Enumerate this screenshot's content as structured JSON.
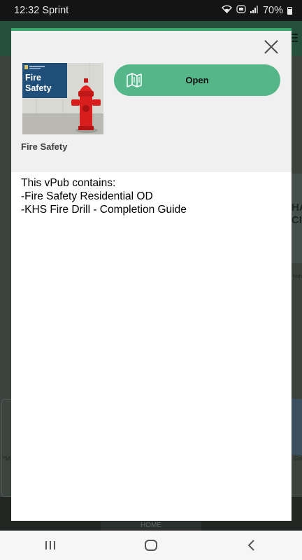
{
  "status_bar": {
    "time_carrier": "12:32 Sprint",
    "battery_text": "70%",
    "icons": [
      "wifi-icon",
      "volte-icon",
      "signal-icon",
      "battery-icon"
    ]
  },
  "background": {
    "tab_home": "HOME",
    "card_fragment": "HA\nCI",
    "side_text": "hari",
    "left_item_text": "*M",
    "right_item_text": "Gri"
  },
  "modal": {
    "close_icon": "close-icon",
    "open_button": {
      "label": "Open",
      "icon": "book-icon"
    },
    "thumbnail": {
      "heading_lines": [
        "Fire",
        "Safety"
      ]
    },
    "publication_title": "Fire Safety",
    "description_lines": [
      "This vPub contains:",
      "-Fire Safety Residential OD",
      "-KHS Fire Drill - Completion Guide"
    ],
    "accent_color": "#39a56f",
    "button_color": "#55b789"
  },
  "nav_bar": {
    "buttons": [
      "recent-apps-icon",
      "home-icon",
      "back-icon"
    ]
  }
}
